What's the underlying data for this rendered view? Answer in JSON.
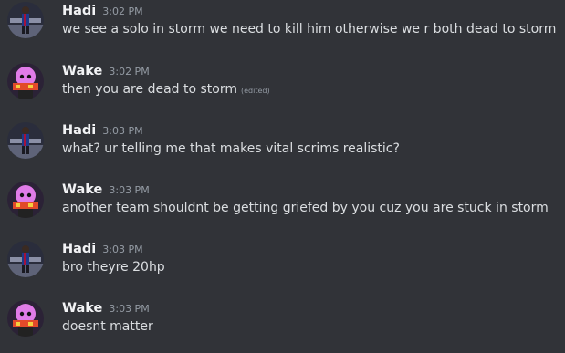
{
  "messages": [
    {
      "author": "Hadi",
      "time": "3:02 PM",
      "text": "we see a solo in storm we need to kill him otherwise we r both dead to storm",
      "edited": ""
    },
    {
      "author": "Wake",
      "time": "3:02 PM",
      "text": "then you are dead to storm",
      "edited": "(edited)"
    },
    {
      "author": "Hadi",
      "time": "3:03 PM",
      "text": "what? ur telling me that makes vital scrims realistic?",
      "edited": ""
    },
    {
      "author": "Wake",
      "time": "3:03 PM",
      "text": "another team shouldnt be getting griefed by you cuz you are stuck in storm",
      "edited": ""
    },
    {
      "author": "Hadi",
      "time": "3:03 PM",
      "text": "bro theyre 20hp",
      "edited": ""
    },
    {
      "author": "Wake",
      "time": "3:03 PM",
      "text": "doesnt matter",
      "edited": ""
    }
  ],
  "colors": {
    "background": "#313338",
    "username": "#f2f3f5",
    "timestamp": "#949ba4",
    "message_text": "#dbdee1"
  }
}
